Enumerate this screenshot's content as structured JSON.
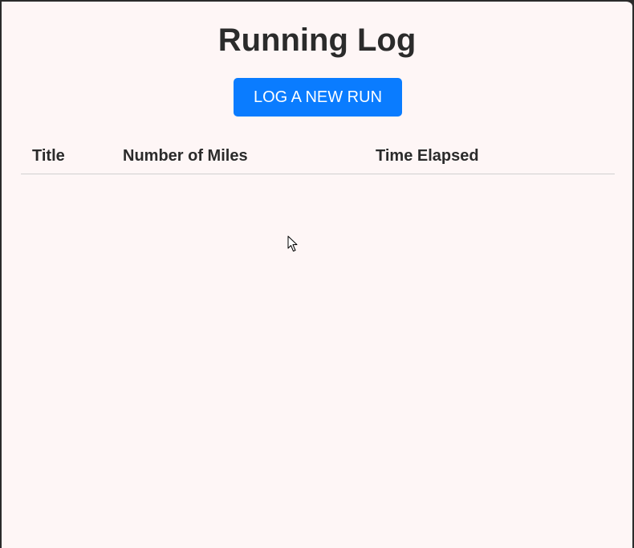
{
  "page": {
    "title": "Running Log",
    "new_run_button": "LOG A NEW RUN"
  },
  "table": {
    "headers": [
      "Title",
      "Number of Miles",
      "Time Elapsed"
    ],
    "rows": []
  },
  "colors": {
    "background": "#fef6f6",
    "primary": "#0a7cff",
    "text": "#2b2b2b",
    "divider": "#d0d0d0"
  },
  "icons": {
    "cursor": "mouse-pointer-icon"
  }
}
